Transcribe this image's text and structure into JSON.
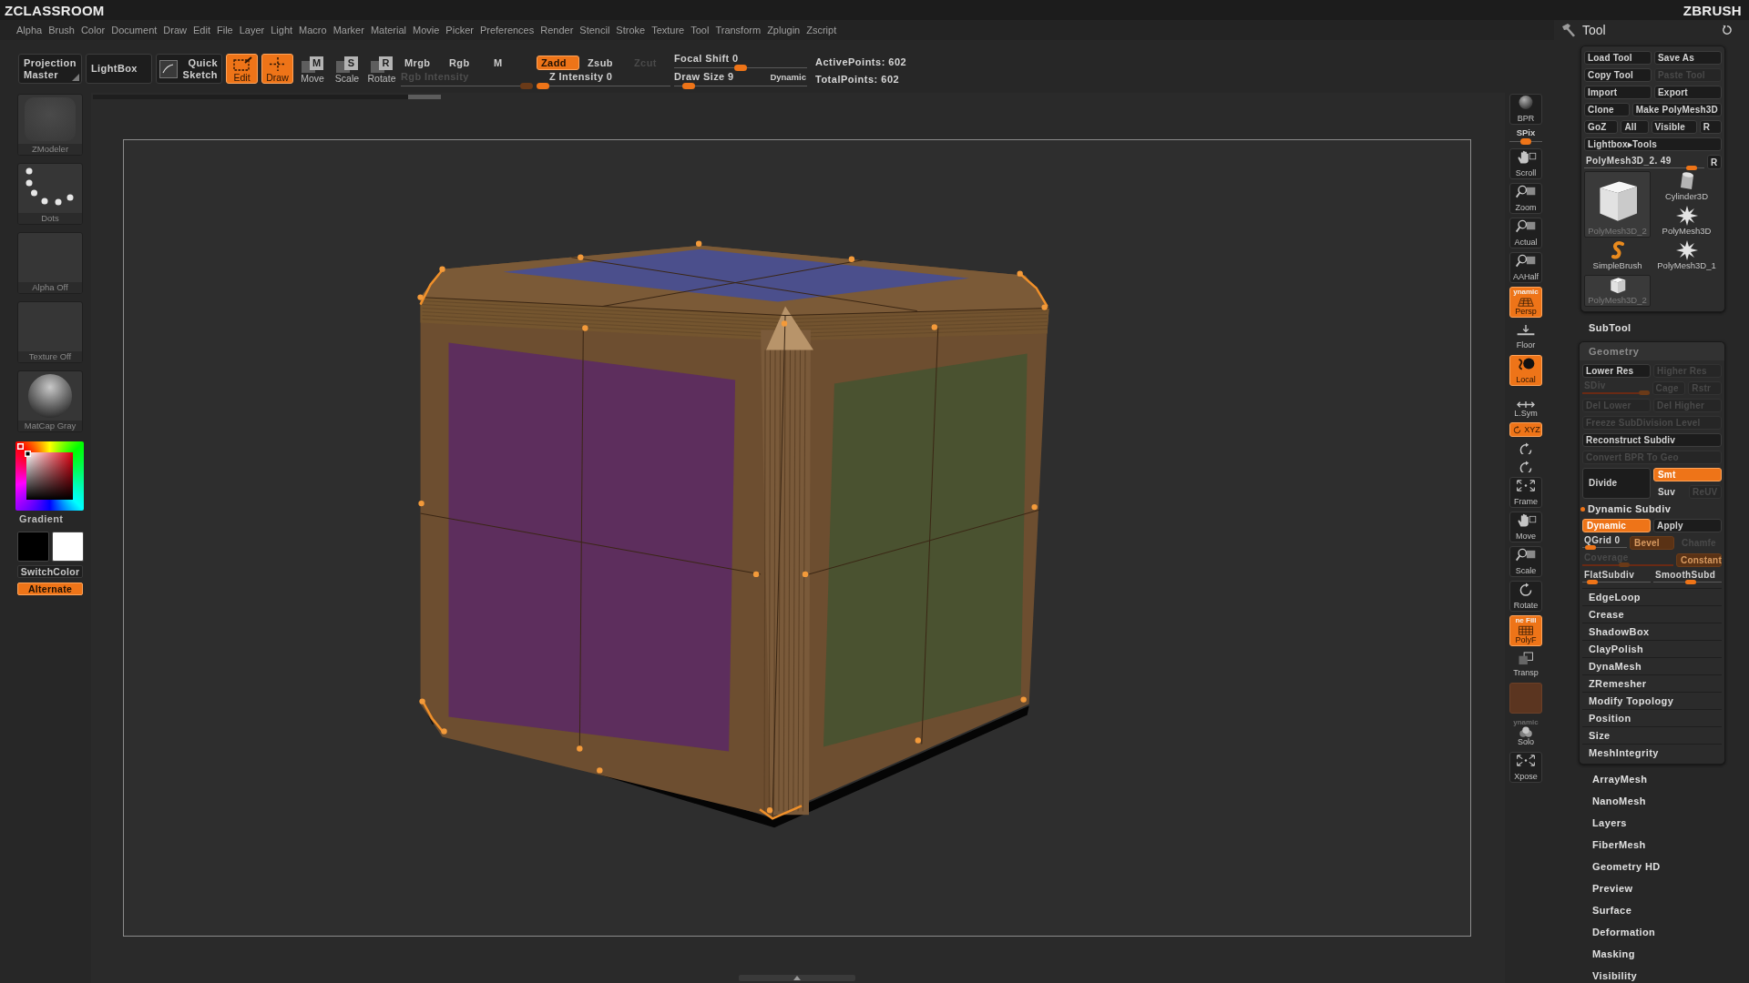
{
  "header": {
    "logo": "ZCLASSROOM",
    "brand": "ZBRUSH"
  },
  "menu": [
    "Alpha",
    "Brush",
    "Color",
    "Document",
    "Draw",
    "Edit",
    "File",
    "Layer",
    "Light",
    "Macro",
    "Marker",
    "Material",
    "Movie",
    "Picker",
    "Preferences",
    "Render",
    "Stencil",
    "Stroke",
    "Texture",
    "Tool",
    "Transform",
    "Zplugin",
    "Zscript"
  ],
  "toolbar": {
    "buttons": [
      {
        "kind": "projection",
        "label": "Projection Master"
      },
      {
        "kind": "plain",
        "label": "LightBox"
      },
      {
        "kind": "sketch",
        "label": "Quick Sketch"
      }
    ],
    "modes": [
      {
        "kind": "edit",
        "label": "Edit",
        "selected": true
      },
      {
        "kind": "draw",
        "label": "Draw",
        "selected": true
      },
      {
        "kind": "move",
        "label": "Move",
        "key": "M",
        "selected": false
      },
      {
        "kind": "scale",
        "label": "Scale",
        "key": "S",
        "selected": false
      },
      {
        "kind": "rotate",
        "label": "Rotate",
        "key": "R",
        "selected": false
      }
    ],
    "color_modes": [
      {
        "label": "Mrgb",
        "selected": false
      },
      {
        "label": "Rgb",
        "selected": false
      },
      {
        "label": "M",
        "selected": false
      }
    ],
    "rgb_intensity": {
      "label": "Rgb Intensity",
      "disabled": true,
      "level": 1
    },
    "z_modes": [
      {
        "label": "Zadd",
        "selected": true,
        "disabled": false
      },
      {
        "label": "Zsub",
        "selected": false,
        "disabled": false
      },
      {
        "label": "Zcut",
        "selected": false,
        "disabled": true
      }
    ],
    "z_intensity": {
      "label": "Z Intensity",
      "value": "0",
      "level": 0
    },
    "focal_shift": {
      "label": "Focal Shift",
      "value": "0",
      "level": 0.5
    },
    "draw_size": {
      "label": "Draw Size",
      "value": "9",
      "level": 0.07
    },
    "dynamic": {
      "label": "Dynamic",
      "on": false
    },
    "stats": [
      "ActivePoints: 602",
      "TotalPoints: 602"
    ]
  },
  "left_shelf": {
    "tiles": [
      {
        "kind": "brush",
        "caption": "ZModeler"
      },
      {
        "kind": "stroke",
        "caption": "Dots"
      },
      {
        "kind": "alpha",
        "caption": "Alpha Off"
      },
      {
        "kind": "texture",
        "caption": "Texture Off"
      },
      {
        "kind": "material",
        "caption": "MatCap Gray"
      }
    ],
    "gradient": {
      "label": "Gradient",
      "on": false
    },
    "swatches": [
      {
        "color": "#000000"
      },
      {
        "color": "#ffffff"
      }
    ],
    "switch_color": {
      "label": "SwitchColor"
    },
    "alternate": {
      "label": "Alternate",
      "on": true
    }
  },
  "right_shelf": [
    {
      "kind": "bpr",
      "label": "BPR",
      "on": false,
      "disabled": false
    },
    {
      "kind": "spix",
      "label": "SPix",
      "level": 0.5
    },
    {
      "kind": "scroll",
      "label": "Scroll",
      "on": false,
      "disabled": false
    },
    {
      "kind": "zoom",
      "label": "Zoom",
      "on": false,
      "disabled": false
    },
    {
      "kind": "actual",
      "label": "Actual",
      "on": false,
      "disabled": false
    },
    {
      "kind": "aahalf",
      "label": "AAHalf",
      "on": false,
      "disabled": false
    },
    {
      "kind": "persp",
      "caption": "ynamic",
      "label": "Persp",
      "on": true,
      "disabled": false
    },
    {
      "kind": "floor",
      "label": "Floor",
      "on": false,
      "disabled": false
    },
    {
      "kind": "local",
      "label": "Local",
      "on": true,
      "disabled": false
    },
    {
      "kind": "lsym",
      "label": "L.Sym",
      "on": false,
      "disabled": false
    },
    {
      "kind": "xyz",
      "label": "XYZ",
      "on": true,
      "disabled": false
    },
    {
      "kind": "rot_y",
      "on": false,
      "disabled": false
    },
    {
      "kind": "rot_z",
      "on": false,
      "disabled": false
    },
    {
      "kind": "frame",
      "label": "Frame",
      "on": false,
      "disabled": false
    },
    {
      "kind": "move",
      "label": "Move",
      "on": false,
      "disabled": false
    },
    {
      "kind": "scale",
      "label": "Scale",
      "on": false,
      "disabled": false
    },
    {
      "kind": "rotate",
      "label": "Rotate",
      "on": false,
      "disabled": false
    },
    {
      "kind": "polyf",
      "caption": "ne Fill",
      "label": "PolyF",
      "on": true,
      "disabled": false
    },
    {
      "kind": "transp",
      "label": "Transp",
      "on": false,
      "disabled": false
    },
    {
      "kind": "ghost",
      "on": true,
      "disabled": true
    },
    {
      "kind": "solo",
      "caption": "ynamic",
      "label": "Solo",
      "on": false,
      "disabled": false
    },
    {
      "kind": "xpose",
      "label": "Xpose",
      "on": false,
      "disabled": false
    }
  ],
  "tool": {
    "title": "Tool",
    "rows": [
      {
        "items": [
          {
            "label": "Load Tool",
            "disabled": false
          },
          {
            "label": "Save As",
            "disabled": false
          }
        ]
      },
      {
        "items": [
          {
            "label": "Copy Tool",
            "disabled": false
          },
          {
            "label": "Paste Tool",
            "disabled": true
          }
        ]
      },
      {
        "items": [
          {
            "label": "Import",
            "disabled": false
          },
          {
            "label": "Export",
            "disabled": false
          }
        ]
      },
      {
        "items": [
          {
            "label": "Clone",
            "disabled": false
          },
          {
            "label": "Make PolyMesh3D",
            "disabled": false
          }
        ]
      },
      {
        "items": [
          {
            "label": "GoZ",
            "disabled": false
          },
          {
            "label": "All",
            "disabled": false
          },
          {
            "label": "Visible",
            "disabled": false
          },
          {
            "label": "R",
            "disabled": false
          }
        ]
      },
      {
        "items": [
          {
            "label": "Lightbox▸Tools",
            "disabled": false
          }
        ]
      }
    ],
    "current": {
      "label": "PolyMesh3D_2.",
      "value": "49",
      "level": 0.93,
      "reset": "R"
    },
    "thumbnails": [
      {
        "kind": "cylinder",
        "label": "Cylinder3D",
        "selected": false
      },
      {
        "kind": "cube",
        "label": "PolyMesh3D_2",
        "selected": true
      },
      {
        "kind": "star",
        "label": "PolyMesh3D",
        "selected": false
      },
      {
        "kind": "squiggle",
        "label": "SimpleBrush",
        "selected": false
      },
      {
        "kind": "star",
        "label": "PolyMesh3D_1",
        "selected": false
      },
      {
        "kind": "cube",
        "label": "PolyMesh3D_2",
        "selected": false
      }
    ],
    "subtool": "SubTool",
    "geometry": {
      "title": "Geometry",
      "rows": [
        {
          "items": [
            {
              "kind": "button",
              "label": "Lower Res",
              "on": false,
              "disabled": false
            },
            {
              "kind": "button",
              "label": "Higher Res",
              "on": false,
              "disabled": true
            }
          ]
        },
        {
          "items": [
            {
              "kind": "slider",
              "label": "SDiv",
              "level": 1,
              "disabled": true
            },
            {
              "kind": "button",
              "label": "Cage",
              "on": false,
              "disabled": true
            },
            {
              "kind": "button",
              "label": "Rstr",
              "on": false,
              "disabled": true
            }
          ]
        },
        {
          "items": [
            {
              "kind": "button",
              "label": "Del Lower",
              "on": false,
              "disabled": true
            },
            {
              "kind": "button",
              "label": "Del Higher",
              "on": false,
              "disabled": true
            }
          ]
        },
        {
          "items": [
            {
              "kind": "button",
              "label": "Freeze SubDivision Level",
              "on": false,
              "disabled": true
            }
          ]
        },
        {
          "items": [
            {
              "kind": "button",
              "label": "Reconstruct Subdiv",
              "on": false,
              "disabled": false
            }
          ]
        },
        {
          "items": [
            {
              "kind": "button",
              "label": "Convert BPR To Geo",
              "on": false,
              "disabled": true
            }
          ]
        }
      ],
      "divide": {
        "label": "Divide",
        "disabled": false,
        "options": [
          {
            "kind": "toggle",
            "label": "Smt",
            "on": true,
            "disabled": false
          },
          {
            "kind": "toggle",
            "label": "Suv",
            "on": false,
            "disabled": false
          },
          {
            "kind": "button",
            "label": "ReUV",
            "on": false,
            "disabled": true
          }
        ]
      },
      "dynamic_subdiv": {
        "title": "Dynamic Subdiv",
        "active": true,
        "rows": [
          {
            "items": [
              {
                "kind": "toggle",
                "label": "Dynamic",
                "on": true,
                "disabled": false
              },
              {
                "kind": "button",
                "label": "Apply",
                "on": false,
                "disabled": false
              }
            ]
          },
          {
            "items": [
              {
                "kind": "slider",
                "label": "QGrid",
                "value": "0",
                "level": 0.08,
                "disabled": false
              },
              {
                "kind": "toggle",
                "label": "Bevel",
                "on": true,
                "disabled": true
              },
              {
                "kind": "toggle",
                "label": "Chamfe",
                "on": false,
                "disabled": true
              }
            ]
          },
          {
            "items": [
              {
                "kind": "slider",
                "label": "Coverage",
                "level": 0.45,
                "disabled": true
              },
              {
                "kind": "toggle",
                "label": "Constant",
                "on": true,
                "disabled": true
              }
            ]
          },
          {
            "items": [
              {
                "kind": "slider",
                "label": "FlatSubdiv",
                "level": 0.08,
                "disabled": false
              },
              {
                "kind": "slider",
                "label": "SmoothSubd",
                "level": 0.55,
                "disabled": false
              }
            ]
          }
        ]
      },
      "subpalettes": [
        "EdgeLoop",
        "Crease",
        "ShadowBox",
        "ClayPolish",
        "DynaMesh",
        "ZRemesher",
        "Modify Topology",
        "Position",
        "Size",
        "MeshIntegrity"
      ]
    }
  },
  "palettes": [
    "ArrayMesh",
    "NanoMesh",
    "Layers",
    "FiberMesh",
    "Geometry HD",
    "Preview",
    "Surface",
    "Deformation",
    "Masking",
    "Visibility"
  ]
}
